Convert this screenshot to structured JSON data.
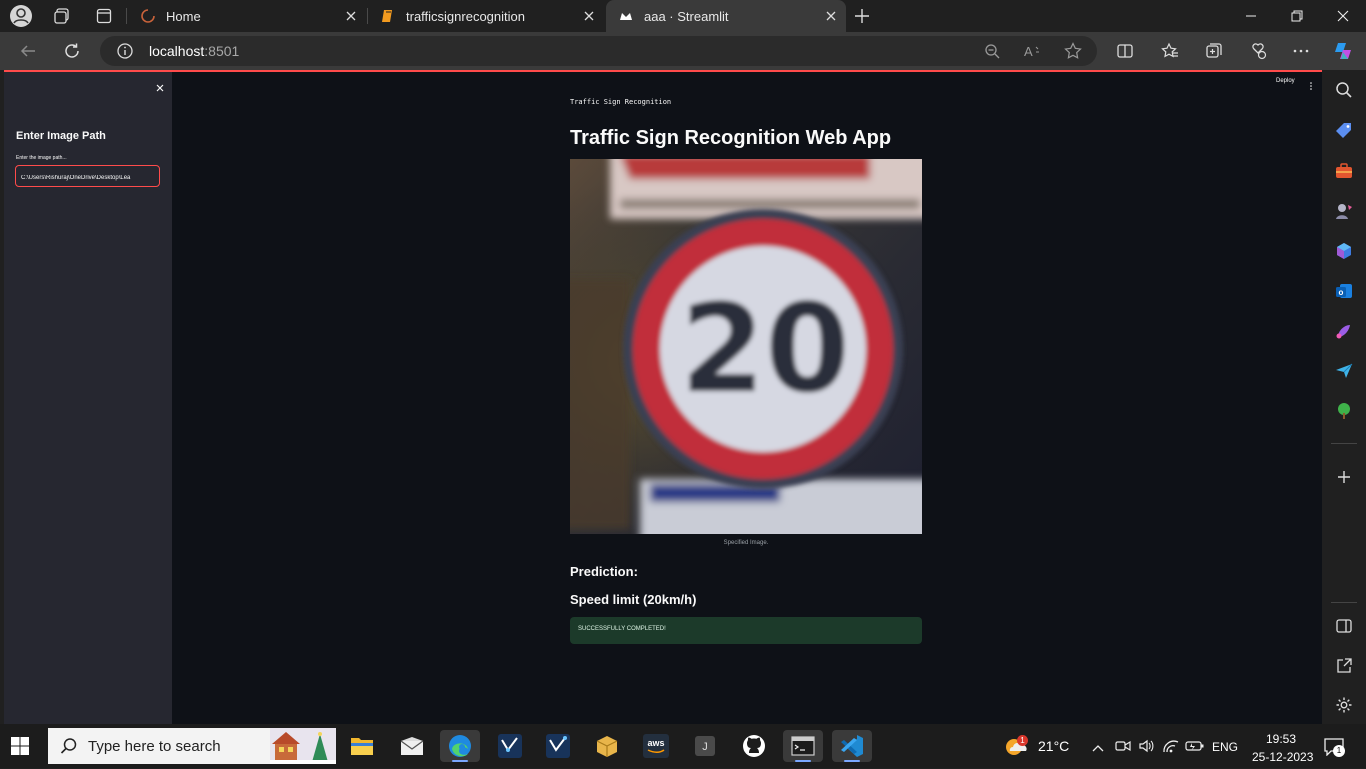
{
  "browser": {
    "tabs": [
      {
        "title": "Home",
        "active": false
      },
      {
        "title": "trafficsignrecognition",
        "active": false
      },
      {
        "title": "aaa · Streamlit",
        "active": true
      }
    ],
    "url_host": "localhost",
    "url_port": ":8501"
  },
  "sidebar": {
    "title": "Enter Image Path",
    "input_label": "Enter the image path...",
    "input_value": "C:\\Users\\Rishuraj\\OneDrive\\Desktop\\Lea"
  },
  "toolbar": {
    "deploy_label": "Deploy"
  },
  "app": {
    "top_text": "Traffic Sign Recognition",
    "title": "Traffic Sign Recognition Web App",
    "image_caption": "Specified Image.",
    "image_sign_text": "20",
    "prediction_label": "Prediction:",
    "prediction_value": "Speed limit (20km/h)",
    "success_text": "SUCCESSFULLY COMPLETED!"
  },
  "taskbar": {
    "search_placeholder": "Type here to search",
    "weather_temp": "21°C",
    "weather_badge": "1",
    "language": "ENG",
    "time": "19:53",
    "date": "25-12-2023",
    "notification_count": "1"
  },
  "colors": {
    "accent": "#ff4b4b",
    "app_bg": "#0e1117",
    "sidebar_bg": "#262730",
    "success_bg": "#1c3a2a"
  }
}
